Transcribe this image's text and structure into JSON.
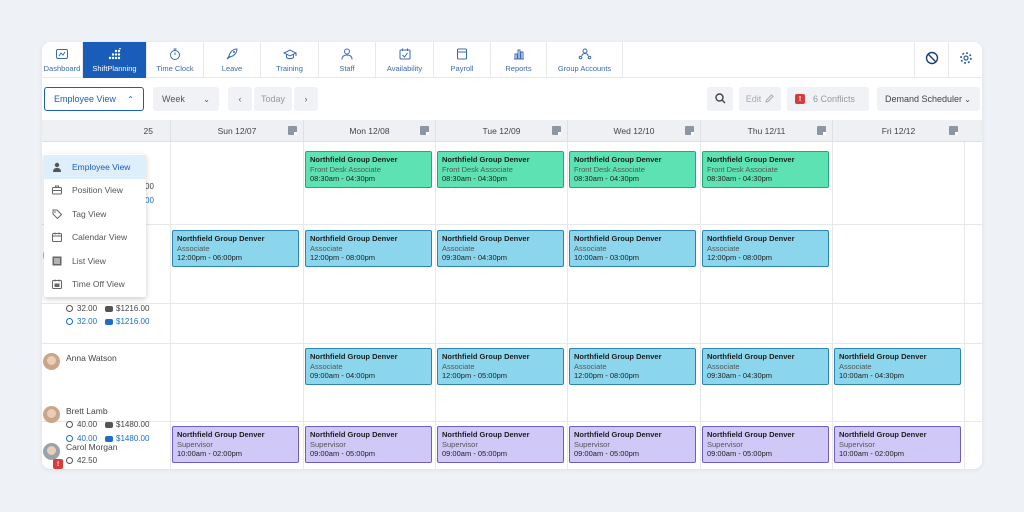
{
  "nav": {
    "items": [
      {
        "label": "Dashboard",
        "icon": "dashboard-icon",
        "active": false
      },
      {
        "label": "ShiftPlanning",
        "icon": "shiftplanning-icon",
        "active": true
      },
      {
        "label": "Time Clock",
        "icon": "stopwatch-icon",
        "active": false
      },
      {
        "label": "Leave",
        "icon": "rocket-icon",
        "active": false
      },
      {
        "label": "Training",
        "icon": "graduation-cap-icon",
        "active": false
      },
      {
        "label": "Staff",
        "icon": "person-icon",
        "active": false
      },
      {
        "label": "Availability",
        "icon": "calendar-check-icon",
        "active": false
      },
      {
        "label": "Payroll",
        "icon": "wallet-icon",
        "active": false
      },
      {
        "label": "Reports",
        "icon": "bar-chart-icon",
        "active": false
      },
      {
        "label": "Group Accounts",
        "icon": "group-icon",
        "active": false
      }
    ]
  },
  "toolbar": {
    "view_label": "Employee View",
    "range_label": "Week",
    "today_label": "Today",
    "edit_label": "Edit",
    "conflicts_label": "6 Conflicts",
    "scheduler_label": "Demand Scheduler"
  },
  "dropdown": {
    "items": [
      "Employee View",
      "Position View",
      "Tag View",
      "Calendar View",
      "List View",
      "Time Off View"
    ],
    "selected": "Employee View"
  },
  "grid": {
    "partial_header": "25",
    "days": [
      "Sun 12/07",
      "Mon 12/08",
      "Tue 12/09",
      "Wed 12/10",
      "Thu 12/11",
      "Fri 12/12"
    ]
  },
  "employees": [
    {
      "name": "",
      "hours": "",
      "cost": "",
      "hours2": "00",
      "cost2": "00"
    },
    {
      "name": "",
      "hours": "32.00",
      "cost": "$1216.00",
      "hours2": "32.00",
      "cost2": "$1216.00"
    },
    {
      "name": "Anna Watson"
    },
    {
      "name": "Brett Lamb",
      "hours": "40.00",
      "cost": "$1480.00",
      "hours2": "40.00",
      "cost2": "$1480.00"
    },
    {
      "name": "Carol Morgan",
      "hours": "42.50"
    }
  ],
  "shifts": {
    "row1": [
      null,
      {
        "loc": "Northfield Group Denver",
        "pos": "Front Desk Associate",
        "time": "08:30am - 04:30pm",
        "color": "green"
      },
      {
        "loc": "Northfield Group Denver",
        "pos": "Front Desk Associate",
        "time": "08:30am - 04:30pm",
        "color": "green"
      },
      {
        "loc": "Northfield Group Denver",
        "pos": "Front Desk Associate",
        "time": "08:30am - 04:30pm",
        "color": "green"
      },
      {
        "loc": "Northfield Group Denver",
        "pos": "Front Desk Associate",
        "time": "08:30am - 04:30pm",
        "color": "green"
      },
      null
    ],
    "row2": [
      {
        "loc": "Northfield Group Denver",
        "pos": "Associate",
        "time": "12:00pm - 06:00pm",
        "color": "blue"
      },
      {
        "loc": "Northfield Group Denver",
        "pos": "Associate",
        "time": "12:00pm - 08:00pm",
        "color": "blue"
      },
      {
        "loc": "Northfield Group Denver",
        "pos": "Associate",
        "time": "09:30am - 04:30pm",
        "color": "blue"
      },
      {
        "loc": "Northfield Group Denver",
        "pos": "Associate",
        "time": "10:00am - 03:00pm",
        "color": "blue"
      },
      {
        "loc": "Northfield Group Denver",
        "pos": "Associate",
        "time": "12:00pm - 08:00pm",
        "color": "blue"
      },
      null
    ],
    "row4": [
      null,
      {
        "loc": "Northfield Group Denver",
        "pos": "Associate",
        "time": "09:00am - 04:00pm",
        "color": "blue"
      },
      {
        "loc": "Northfield Group Denver",
        "pos": "Associate",
        "time": "12:00pm - 05:00pm",
        "color": "blue"
      },
      {
        "loc": "Northfield Group Denver",
        "pos": "Associate",
        "time": "12:00pm - 08:00pm",
        "color": "blue"
      },
      {
        "loc": "Northfield Group Denver",
        "pos": "Associate",
        "time": "09:30am - 04:30pm",
        "color": "blue"
      },
      {
        "loc": "Northfield Group Denver",
        "pos": "Associate",
        "time": "10:00am - 04:30pm",
        "color": "blue"
      }
    ],
    "row5": [
      {
        "loc": "Northfield Group Denver",
        "pos": "Supervisor",
        "time": "10:00am - 02:00pm",
        "color": "purple"
      },
      {
        "loc": "Northfield Group Denver",
        "pos": "Supervisor",
        "time": "09:00am - 05:00pm",
        "color": "purple"
      },
      {
        "loc": "Northfield Group Denver",
        "pos": "Supervisor",
        "time": "09:00am - 05:00pm",
        "color": "purple"
      },
      {
        "loc": "Northfield Group Denver",
        "pos": "Supervisor",
        "time": "09:00am - 05:00pm",
        "color": "purple"
      },
      {
        "loc": "Northfield Group Denver",
        "pos": "Supervisor",
        "time": "09:00am - 05:00pm",
        "color": "purple"
      },
      {
        "loc": "Northfield Group Denver",
        "pos": "Supervisor",
        "time": "10:00am - 02:00pm",
        "color": "purple"
      }
    ]
  },
  "colors": {
    "accent": "#1a5db8",
    "green": "#5de3b3",
    "blue": "#8bd6ec",
    "purple": "#d0c8f7",
    "warning": "#d83b3b"
  }
}
